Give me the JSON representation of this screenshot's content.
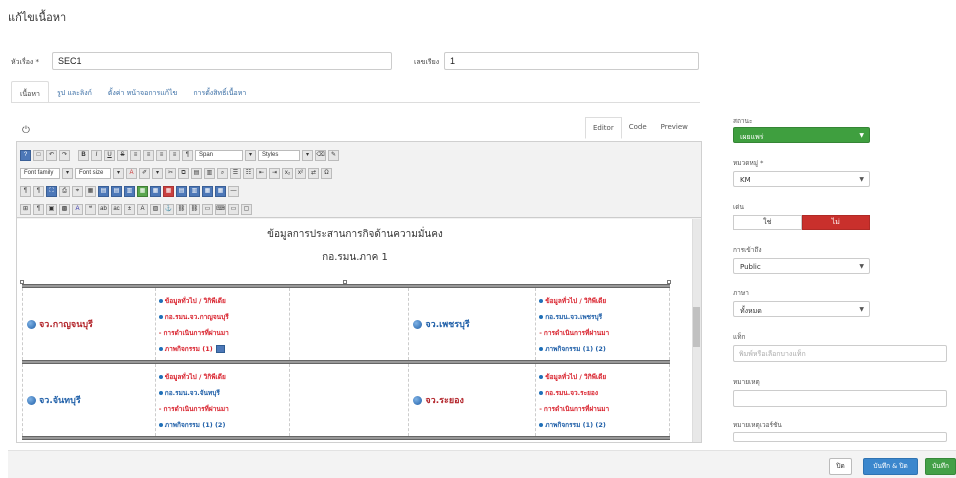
{
  "page": {
    "title": "แก้ไขเนื้อหา"
  },
  "form": {
    "title_label": "หัวเรื่อง *",
    "title_value": "SEC1",
    "order_label": "เลขเรียง",
    "order_value": "1"
  },
  "tabs": [
    {
      "label": "เนื้อหา"
    },
    {
      "label": "รูป และลิงก์"
    },
    {
      "label": "ตั้งค่า หน้าจอการแก้ไข"
    },
    {
      "label": "การตั้งสิทธิ์เนื้อหา"
    }
  ],
  "editor": {
    "modes": [
      {
        "label": "Editor"
      },
      {
        "label": "Code"
      },
      {
        "label": "Preview"
      }
    ],
    "toolbar": {
      "paragraph_select": "Span",
      "styles_select": "Styles",
      "font_family": "Font family",
      "font_size": "Font size"
    }
  },
  "document": {
    "heading": "ข้อมูลการประสานการกิจด้านความมั่นคง",
    "subheading": "กอ.รมน.ภาค 1",
    "rows": [
      {
        "left": {
          "province": "จว.กาญจนบุรี",
          "links": [
            "ข้อมูลทั่วไป / วิกิพีเดีย",
            "กอ.รมน.จว.กาญจนบุรี",
            "การดำเนินการที่ผ่านมา",
            "ภาพกิจกรรม (1)"
          ]
        },
        "right": {
          "province": "จว.เพชรบุรี",
          "links": [
            "ข้อมูลทั่วไป / วิกิพีเดีย",
            "กอ.รมน.จว.เพชรบุรี",
            "การดำเนินการที่ผ่านมา",
            "ภาพกิจกรรม (1) (2)"
          ]
        }
      },
      {
        "left": {
          "province": "จว.จันทบุรี",
          "links": [
            "ข้อมูลทั่วไป / วิกิพีเดีย",
            "กอ.รมน.จว.จันทบุรี",
            "การดำเนินการที่ผ่านมา",
            "ภาพกิจกรรม (1) (2)"
          ]
        },
        "right": {
          "province": "จว.ระยอง",
          "links": [
            "ข้อมูลทั่วไป / วิกิพีเดีย",
            "กอ.รมน.จว.ระยอง",
            "การดำเนินการที่ผ่านมา",
            "ภาพกิจกรรม (1) (2)"
          ]
        }
      }
    ]
  },
  "sidebar": {
    "status_label": "สถานะ",
    "status_value": "เผยแพร่",
    "category_label": "หมวดหมู่ *",
    "category_value": "KM",
    "highlight_label": "เด่น",
    "highlight_yes": "ใช่",
    "highlight_no": "ไม่",
    "access_label": "การเข้าถึง",
    "access_value": "Public",
    "language_label": "ภาษา",
    "language_value": "ทั้งหมด",
    "tags_label": "แท็ก",
    "tags_placeholder": "พิมพ์หรือเลือกบางแท็ก",
    "note_label": "หมายเหตุ",
    "version_note_label": "หมายเหตุเวอร์ชัน"
  },
  "footer": {
    "close_label": "ปิด",
    "save_close_label": "บันทึก & ปิด",
    "save_label": "บันทึก"
  },
  "colors": {
    "status_green": "#3f9f3f",
    "toggle_red": "#c9302c",
    "save_close_blue": "#3b87cd",
    "save_green": "#43a047",
    "province_red": "#b3262c",
    "link_blue": "#1f5fa8"
  }
}
